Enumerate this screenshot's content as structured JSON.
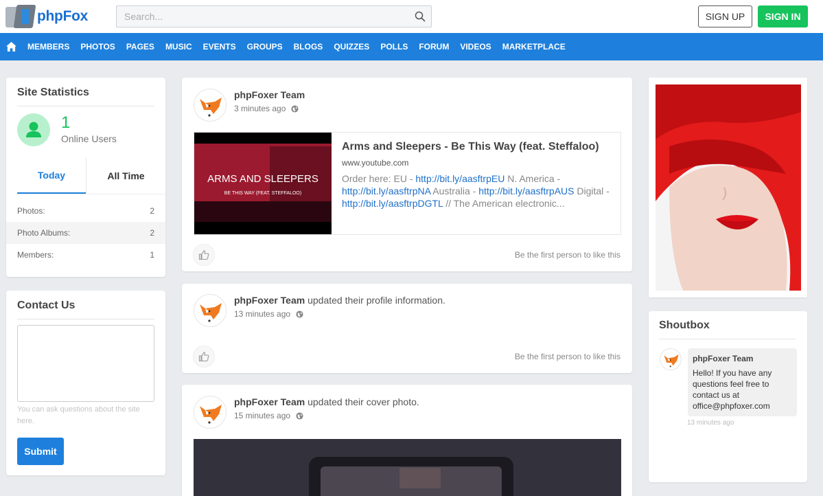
{
  "header": {
    "logo_text": "phpFox",
    "search_placeholder": "Search...",
    "signup_label": "SIGN UP",
    "signin_label": "SIGN IN"
  },
  "nav": {
    "items": [
      "MEMBERS",
      "PHOTOS",
      "PAGES",
      "MUSIC",
      "EVENTS",
      "GROUPS",
      "BLOGS",
      "QUIZZES",
      "POLLS",
      "FORUM",
      "VIDEOS",
      "MARKETPLACE"
    ]
  },
  "stats": {
    "title": "Site Statistics",
    "online_count": "1",
    "online_label": "Online Users",
    "tabs": [
      "Today",
      "All Time"
    ],
    "rows": [
      {
        "label": "Photos:",
        "value": "2"
      },
      {
        "label": "Photo Albums:",
        "value": "2"
      },
      {
        "label": "Members:",
        "value": "1"
      }
    ]
  },
  "contact": {
    "title": "Contact Us",
    "hint": "You can ask questions about the site here.",
    "submit_label": "Submit"
  },
  "feed": {
    "posts": [
      {
        "author": "phpFoxer Team",
        "action": "",
        "time": "3 minutes ago",
        "like_text": "Be the first person to like this",
        "link": {
          "thumb_title": "ARMS AND SLEEPERS",
          "thumb_subtitle": "BE THIS WAY (FEAT. STEFFALOO)",
          "title": "Arms and Sleepers - Be This Way (feat. Steffaloo)",
          "domain": "www.youtube.com",
          "desc_1": "Order here: EU - ",
          "link_1": "http://bit.ly/aasftrpEU",
          "desc_2": " N. America - ",
          "link_2": "http://bit.ly/aasftrpNA",
          "desc_3": " Australia - ",
          "link_3": "http://bit.ly/aasftrpAUS",
          "desc_4": " Digital - ",
          "link_4": "http://bit.ly/aasftrpDGTL",
          "desc_5": " // The American electronic..."
        }
      },
      {
        "author": "phpFoxer Team",
        "action": " updated their profile information.",
        "time": "13 minutes ago",
        "like_text": "Be the first person to like this"
      },
      {
        "author": "phpFoxer Team",
        "action": " updated their cover photo.",
        "time": "15 minutes ago"
      }
    ]
  },
  "shoutbox": {
    "title": "Shoutbox",
    "author": "phpFoxer Team",
    "message": "Hello! If you have any questions feel free to contact us at office@phpfoxer.com",
    "time": "13 minutes ago"
  },
  "colors": {
    "brand_blue": "#1e80dc",
    "signin_green": "#16c35c",
    "background": "#e9ebee"
  },
  "icons": [
    "home-icon",
    "search-icon",
    "user-icon",
    "globe-icon",
    "thumbs-up-icon",
    "fox-avatar-icon"
  ]
}
